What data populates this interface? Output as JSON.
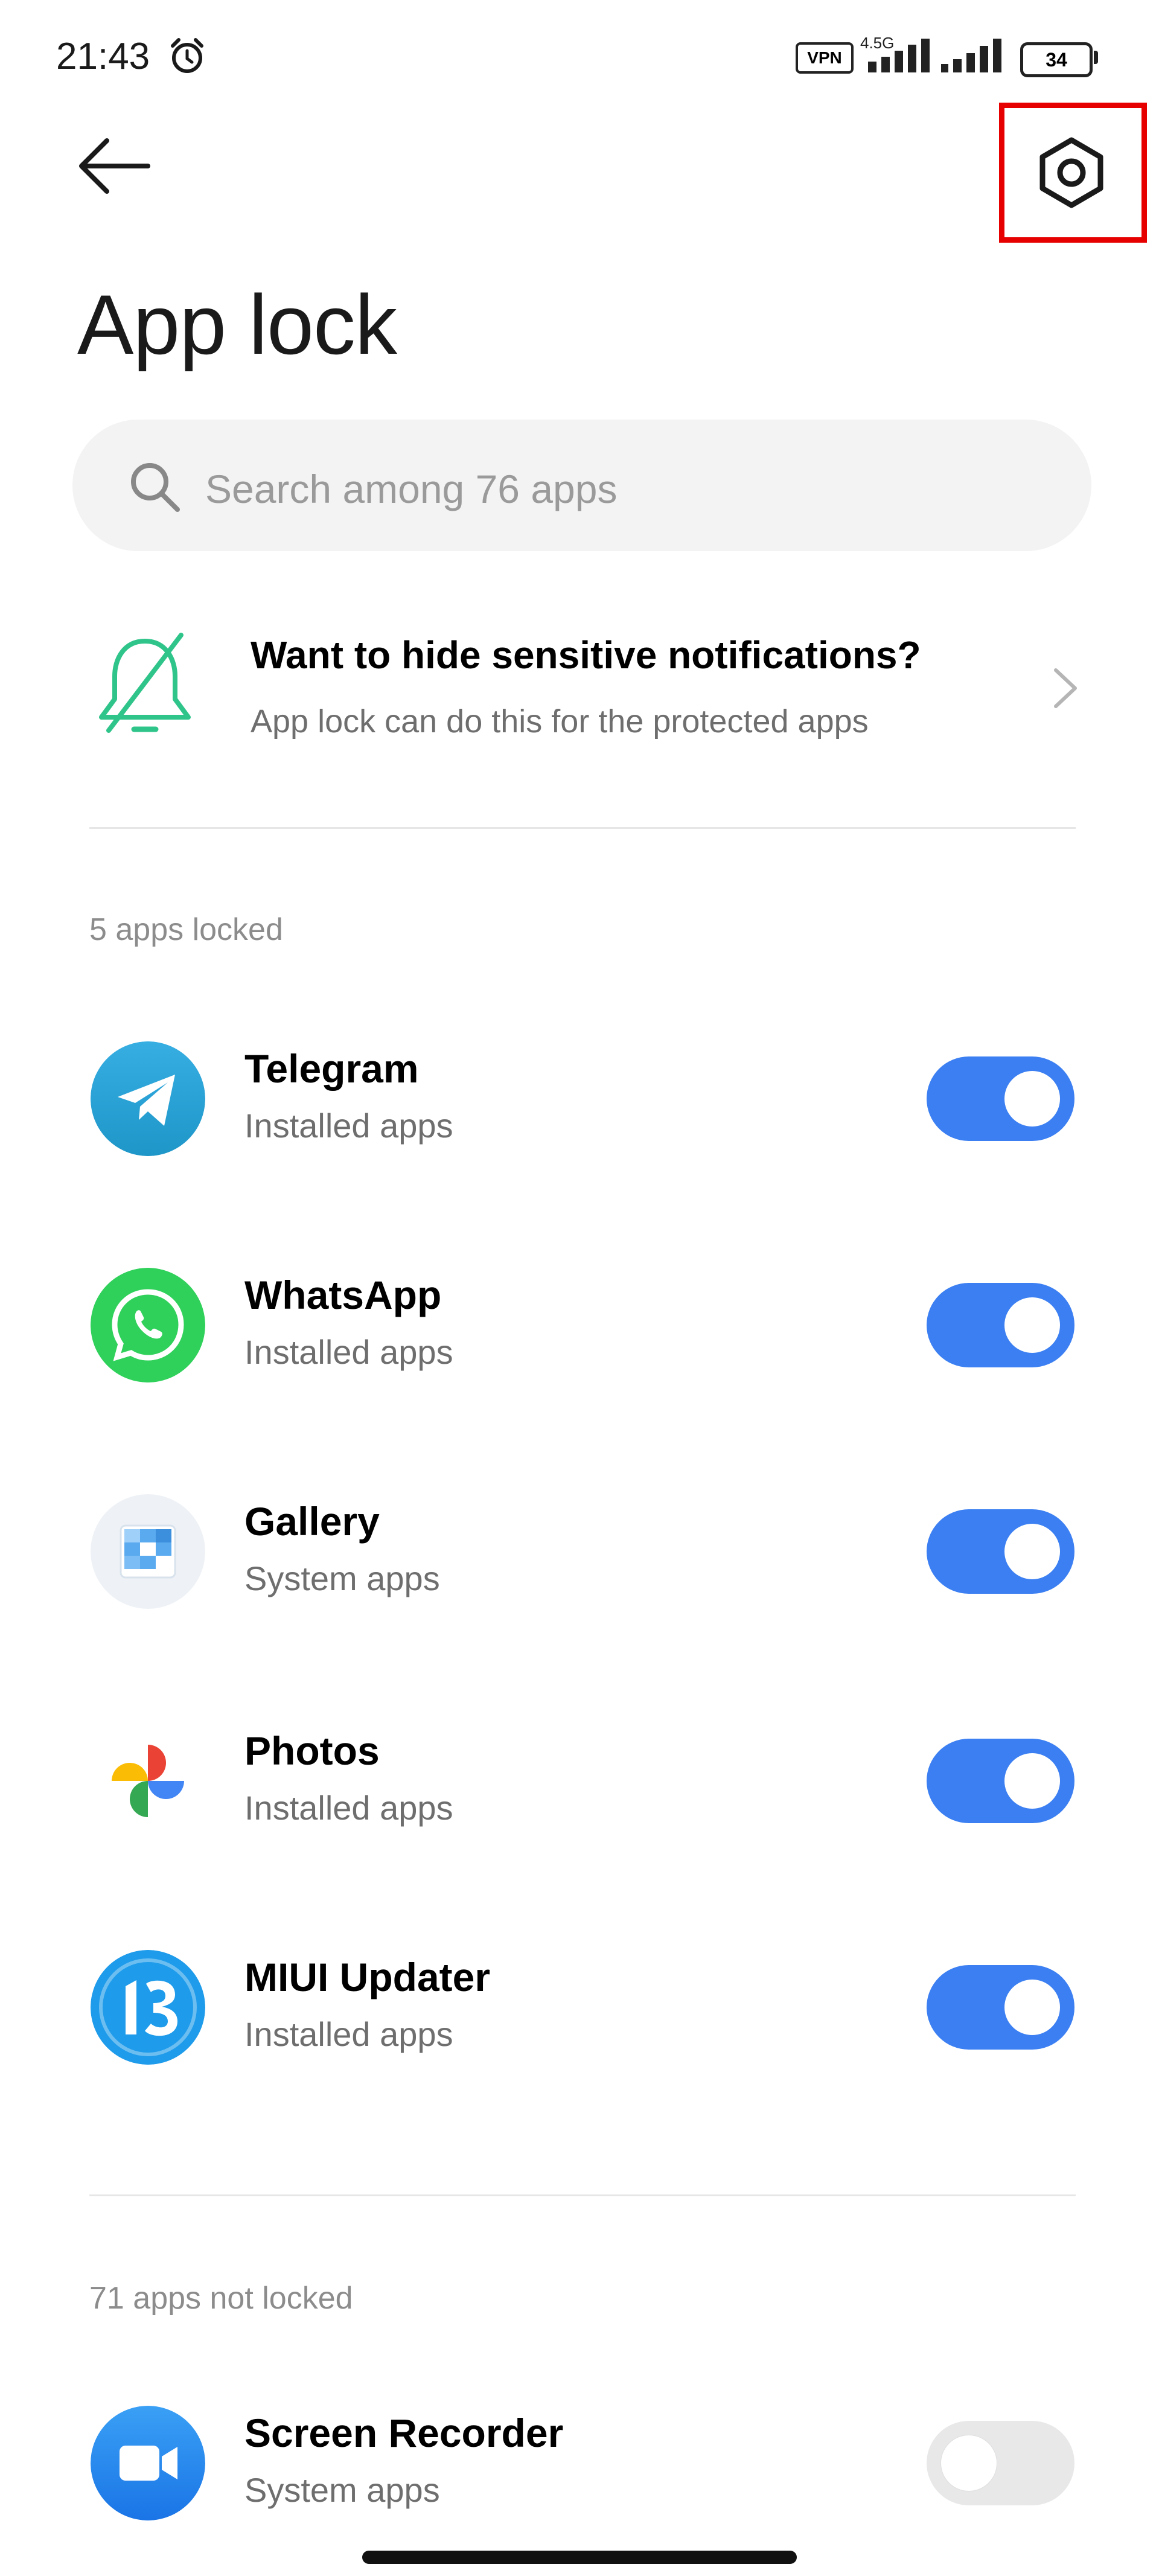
{
  "status_bar": {
    "time": "21:43",
    "vpn_label": "VPN",
    "network_type": "4.5G",
    "battery_level": "34"
  },
  "header": {
    "title": "App lock",
    "back_icon": "back-arrow-icon",
    "settings_icon": "gear-icon",
    "settings_highlight_color": "#e60000"
  },
  "search": {
    "placeholder": "Search among 76 apps"
  },
  "notification_banner": {
    "title": "Want to hide sensitive notifications?",
    "subtitle": "App lock can do this for the protected apps",
    "icon": "bell-off-icon"
  },
  "locked_section": {
    "label": "5 apps locked",
    "apps": [
      {
        "name": "Telegram",
        "type": "Installed apps",
        "locked": true,
        "icon": "telegram-icon"
      },
      {
        "name": "WhatsApp",
        "type": "Installed apps",
        "locked": true,
        "icon": "whatsapp-icon"
      },
      {
        "name": "Gallery",
        "type": "System apps",
        "locked": true,
        "icon": "gallery-icon"
      },
      {
        "name": "Photos",
        "type": "Installed apps",
        "locked": true,
        "icon": "photos-icon"
      },
      {
        "name": "MIUI Updater",
        "type": "Installed apps",
        "locked": true,
        "icon": "miui-updater-icon"
      }
    ]
  },
  "unlocked_section": {
    "label": "71 apps not locked",
    "apps": [
      {
        "name": "Screen Recorder",
        "type": "System apps",
        "locked": false,
        "icon": "screen-recorder-icon"
      }
    ]
  },
  "colors": {
    "toggle_on": "#3b7ff2",
    "toggle_off": "#e8e8e8",
    "accent_green": "#2fc48a"
  }
}
